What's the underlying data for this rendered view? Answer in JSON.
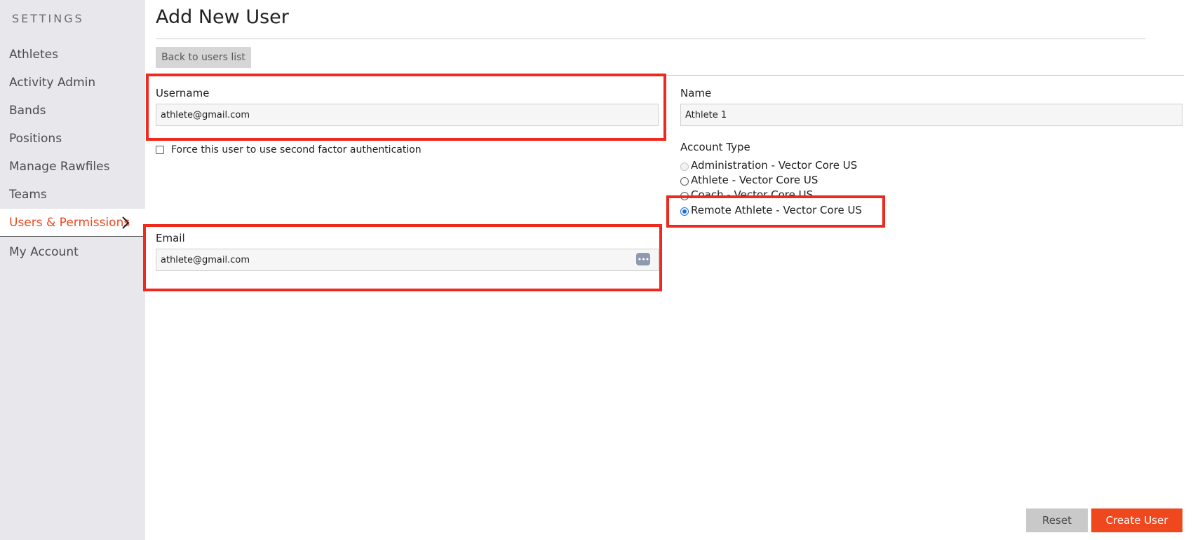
{
  "sidebar": {
    "title": "SETTINGS",
    "items": [
      {
        "label": "Athletes"
      },
      {
        "label": "Activity Admin"
      },
      {
        "label": "Bands"
      },
      {
        "label": "Positions"
      },
      {
        "label": "Manage Rawfiles"
      },
      {
        "label": "Teams"
      },
      {
        "label": "Users & Permissions",
        "active": true
      },
      {
        "label": "My Account"
      }
    ]
  },
  "header": {
    "title": "Add New User",
    "back_label": "Back to users list"
  },
  "form": {
    "username": {
      "label": "Username",
      "value": "athlete@gmail.com"
    },
    "name": {
      "label": "Name",
      "value": "Athlete 1"
    },
    "email": {
      "label": "Email",
      "value": "athlete@gmail.com",
      "icon": "password-manager-icon"
    },
    "two_factor": {
      "label": "Force this user to use second factor authentication",
      "checked": false
    },
    "account_type": {
      "label": "Account Type",
      "options": [
        {
          "label": "Administration - Vector Core US",
          "state": "disabled"
        },
        {
          "label": "Athlete - Vector Core US",
          "state": "unchecked"
        },
        {
          "label": "Coach - Vector Core US",
          "state": "unchecked"
        },
        {
          "label": "Remote Athlete - Vector Core US",
          "state": "checked"
        }
      ]
    }
  },
  "actions": {
    "reset_label": "Reset",
    "create_label": "Create User"
  },
  "colors": {
    "accent": "#f0481e",
    "highlight": "#ee2a1f",
    "sidebar_bg": "#e8e8ec"
  }
}
